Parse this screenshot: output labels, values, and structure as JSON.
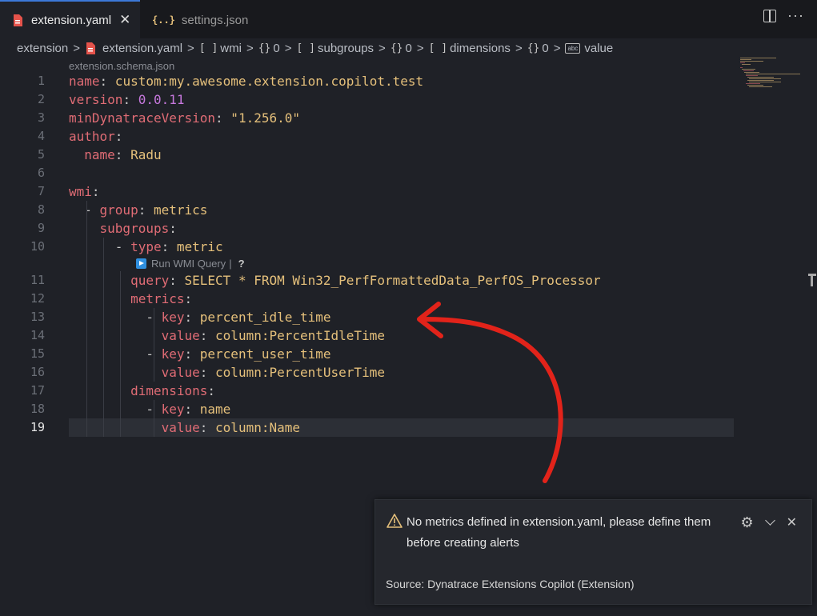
{
  "tabs": [
    {
      "label": "extension.yaml",
      "active": true
    },
    {
      "label": "settings.json",
      "active": false
    }
  ],
  "breadcrumb": {
    "items": [
      {
        "symbol": "",
        "label": "extension"
      },
      {
        "symbol": "",
        "label": "extension.yaml"
      },
      {
        "symbol": "[ ]",
        "label": "wmi"
      },
      {
        "symbol": "{}",
        "label": "0"
      },
      {
        "symbol": "[ ]",
        "label": "subgroups"
      },
      {
        "symbol": "{}",
        "label": "0"
      },
      {
        "symbol": "[ ]",
        "label": "dimensions"
      },
      {
        "symbol": "{}",
        "label": "0"
      },
      {
        "symbol": "abc",
        "label": "value"
      }
    ],
    "separator": ">"
  },
  "editor": {
    "schema_lens": "extension.schema.json",
    "codelens": {
      "run_label": "Run WMI Query",
      "divider": "|",
      "help": "?"
    },
    "current_line": 19,
    "lines": [
      {
        "num": "1",
        "indent": "",
        "dash": "",
        "key": "name",
        "colon": ":",
        "value": " custom:my.awesome.extension.copilot.test",
        "vtype": "v"
      },
      {
        "num": "2",
        "indent": "",
        "dash": "",
        "key": "version",
        "colon": ":",
        "value": " 0.0.11",
        "vtype": "n"
      },
      {
        "num": "3",
        "indent": "",
        "dash": "",
        "key": "minDynatraceVersion",
        "colon": ":",
        "value": " \"1.256.0\"",
        "vtype": "v"
      },
      {
        "num": "4",
        "indent": "",
        "dash": "",
        "key": "author",
        "colon": ":",
        "value": "",
        "vtype": "v"
      },
      {
        "num": "5",
        "indent": "  ",
        "dash": "",
        "key": "name",
        "colon": ":",
        "value": " Radu",
        "vtype": "v"
      },
      {
        "num": "6",
        "indent": "",
        "dash": "",
        "key": "",
        "colon": "",
        "value": "",
        "vtype": "v"
      },
      {
        "num": "7",
        "indent": "",
        "dash": "",
        "key": "wmi",
        "colon": ":",
        "value": "",
        "vtype": "v"
      },
      {
        "num": "8",
        "indent": "  ",
        "dash": "- ",
        "key": "group",
        "colon": ":",
        "value": " metrics",
        "vtype": "v"
      },
      {
        "num": "9",
        "indent": "    ",
        "dash": "",
        "key": "subgroups",
        "colon": ":",
        "value": "",
        "vtype": "v"
      },
      {
        "num": "10",
        "indent": "      ",
        "dash": "- ",
        "key": "type",
        "colon": ":",
        "value": " metric",
        "vtype": "v"
      },
      {
        "num": "11",
        "indent": "        ",
        "dash": "",
        "key": "query",
        "colon": ":",
        "value": " SELECT * FROM Win32_PerfFormattedData_PerfOS_Processor",
        "vtype": "v"
      },
      {
        "num": "12",
        "indent": "        ",
        "dash": "",
        "key": "metrics",
        "colon": ":",
        "value": "",
        "vtype": "v"
      },
      {
        "num": "13",
        "indent": "          ",
        "dash": "- ",
        "key": "key",
        "colon": ":",
        "value": " percent_idle_time",
        "vtype": "v"
      },
      {
        "num": "14",
        "indent": "            ",
        "dash": "",
        "key": "value",
        "colon": ":",
        "value": " column:PercentIdleTime",
        "vtype": "v"
      },
      {
        "num": "15",
        "indent": "          ",
        "dash": "- ",
        "key": "key",
        "colon": ":",
        "value": " percent_user_time",
        "vtype": "v"
      },
      {
        "num": "16",
        "indent": "            ",
        "dash": "",
        "key": "value",
        "colon": ":",
        "value": " column:PercentUserTime",
        "vtype": "v"
      },
      {
        "num": "17",
        "indent": "        ",
        "dash": "",
        "key": "dimensions",
        "colon": ":",
        "value": "",
        "vtype": "v"
      },
      {
        "num": "18",
        "indent": "          ",
        "dash": "- ",
        "key": "key",
        "colon": ":",
        "value": " name",
        "vtype": "v"
      },
      {
        "num": "19",
        "indent": "            ",
        "dash": "",
        "key": "value",
        "colon": ":",
        "value": " column:Name",
        "vtype": "v"
      }
    ]
  },
  "notification": {
    "message": "No metrics defined in extension.yaml, please define them before creating alerts",
    "source": "Source: Dynatrace Extensions Copilot (Extension)"
  },
  "colors": {
    "key": "#e06c75",
    "string": "#e5c07b",
    "number": "#c678dd",
    "annotation_arrow": "#e2231a",
    "warning": "#e5c07b",
    "tab_accent": "#3c78d8"
  }
}
